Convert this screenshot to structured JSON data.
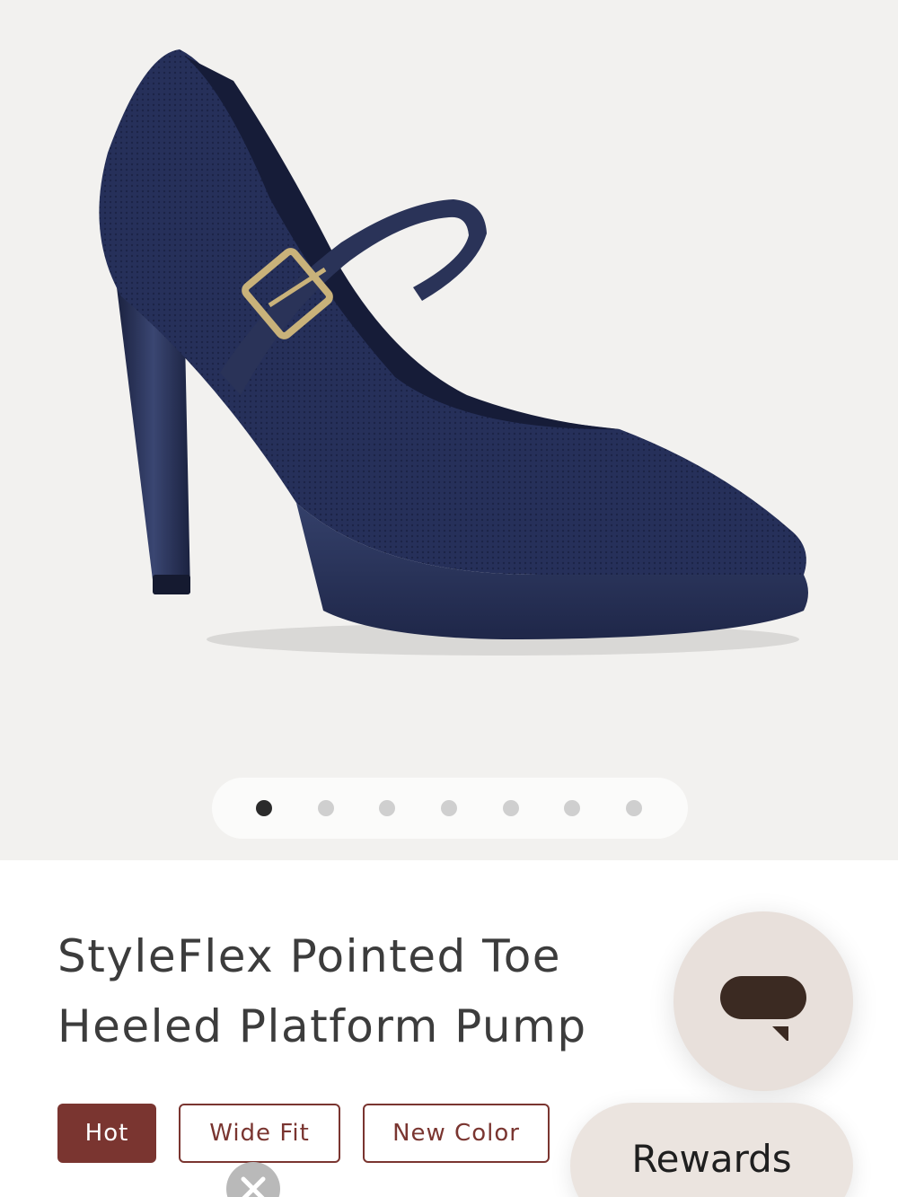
{
  "product": {
    "title_line1": "StyleFlex Pointed Toe",
    "title_line2": "Heeled Platform Pump",
    "image_icon": "navy-mary-jane-pump-image",
    "image_color": "#232b52"
  },
  "gallery": {
    "total_images": 7,
    "active_index": 0
  },
  "tags": {
    "hot": "Hot",
    "wide_fit": "Wide Fit",
    "new_color": "New Color"
  },
  "floating": {
    "chat_icon": "chat-bubble-icon",
    "rewards_label": "Rewards",
    "close_icon": "close-icon"
  },
  "colors": {
    "accent": "#7a3530",
    "gallery_bg": "#f2f1ef",
    "floating_bg": "#e8e0db",
    "text": "#3c3c3c"
  }
}
